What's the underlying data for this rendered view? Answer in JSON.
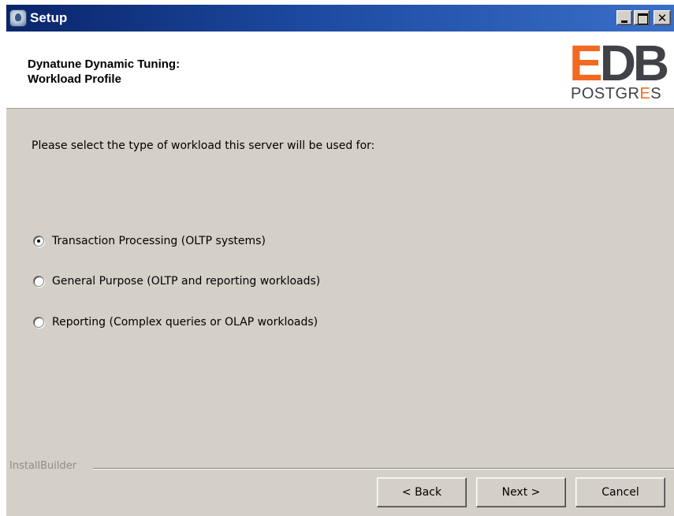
{
  "window": {
    "title": "Setup"
  },
  "header": {
    "title_line1": "Dynatune Dynamic Tuning:",
    "title_line2": "Workload Profile",
    "logo": {
      "letter_e": "E",
      "letters_db": "DB",
      "wordmark_main": "POSTGR",
      "wordmark_highlight": "E",
      "wordmark_end": "S",
      "colors": {
        "accent": "#f26a21",
        "dark": "#404248"
      }
    }
  },
  "content": {
    "prompt": "Please select the type of workload this server will be used for:",
    "options": [
      {
        "label": "Transaction Processing (OLTP systems)",
        "selected": true
      },
      {
        "label": "General Purpose (OLTP and reporting workloads)",
        "selected": false
      },
      {
        "label": "Reporting (Complex queries or OLAP workloads)",
        "selected": false
      }
    ]
  },
  "footer": {
    "brand": "InstallBuilder",
    "buttons": {
      "back": "< Back",
      "next": "Next >",
      "cancel": "Cancel"
    }
  },
  "colors": {
    "titlebar": "#0a246a",
    "dialog_bg": "#d4d0c8"
  }
}
